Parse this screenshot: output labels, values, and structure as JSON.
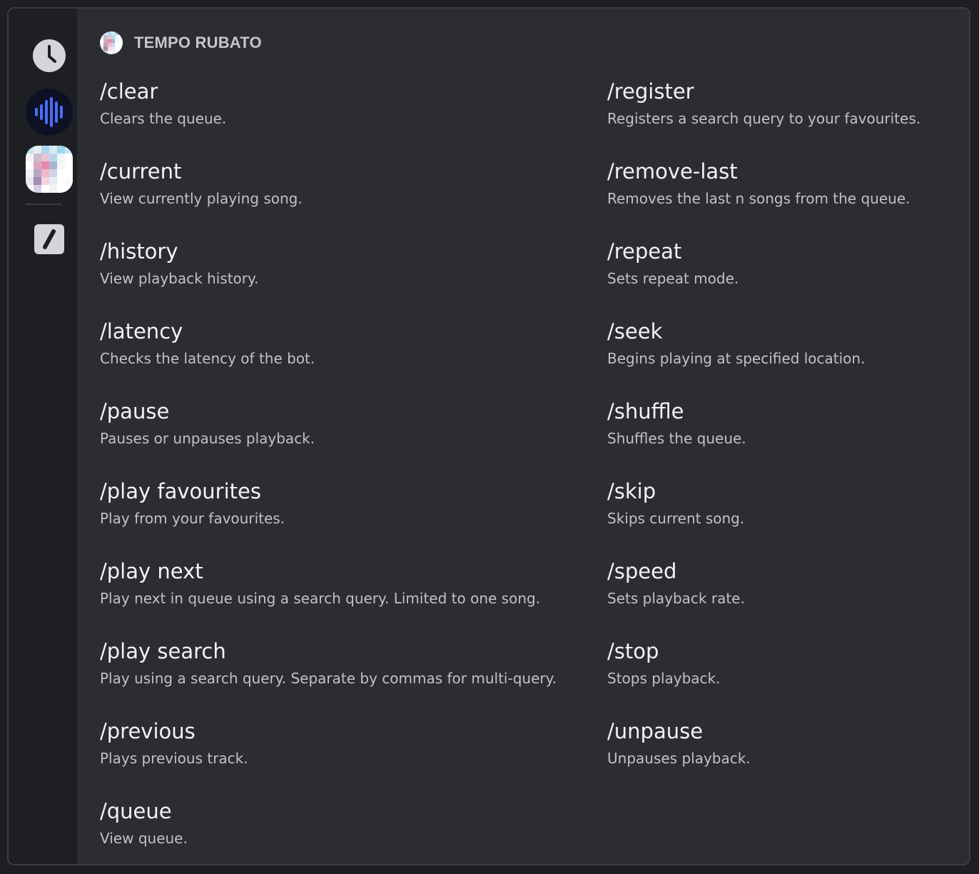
{
  "header": {
    "title": "TEMPO RUBATO",
    "avatar_icon": "app-avatar-icon"
  },
  "rail": {
    "items": [
      {
        "name": "recent-icon"
      },
      {
        "name": "audio-wave-icon"
      },
      {
        "name": "app-icon"
      },
      {
        "name": "slash-commands-icon"
      }
    ],
    "accent_color": "#4a6cf7"
  },
  "commands": {
    "left": [
      {
        "name": "/clear",
        "description": "Clears the queue."
      },
      {
        "name": "/current",
        "description": "View currently playing song."
      },
      {
        "name": "/history",
        "description": "View playback history."
      },
      {
        "name": "/latency",
        "description": "Checks the latency of the bot."
      },
      {
        "name": "/pause",
        "description": "Pauses or unpauses playback."
      },
      {
        "name": "/play favourites",
        "description": "Play from your favourites."
      },
      {
        "name": "/play next",
        "description": "Play next in queue using a search query. Limited to one song."
      },
      {
        "name": "/play search",
        "description": "Play using a search query. Separate by commas for multi-query."
      },
      {
        "name": "/previous",
        "description": "Plays previous track."
      },
      {
        "name": "/queue",
        "description": "View queue."
      }
    ],
    "right": [
      {
        "name": "/register",
        "description": "Registers a search query to your favourites."
      },
      {
        "name": "/remove-last",
        "description": "Removes the last n songs from the queue."
      },
      {
        "name": "/repeat",
        "description": "Sets repeat mode."
      },
      {
        "name": "/seek",
        "description": "Begins playing at specified location."
      },
      {
        "name": "/shuffle",
        "description": "Shuffles the queue."
      },
      {
        "name": "/skip",
        "description": "Skips current song."
      },
      {
        "name": "/speed",
        "description": "Sets playback rate."
      },
      {
        "name": "/stop",
        "description": "Stops playback."
      },
      {
        "name": "/unpause",
        "description": "Unpauses playback."
      }
    ]
  }
}
